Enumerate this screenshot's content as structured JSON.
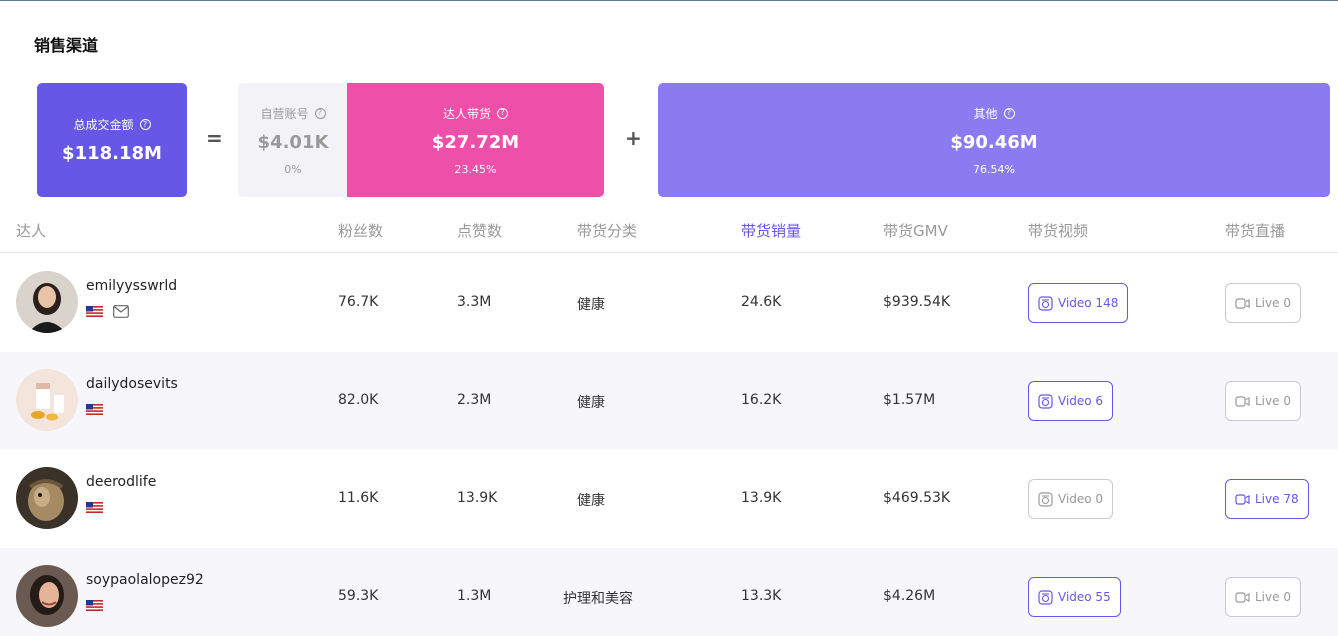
{
  "section_title": "销售渠道",
  "summary": {
    "total": {
      "label": "总成交金额",
      "value": "$118.18M"
    },
    "equals": "=",
    "self": {
      "label": "自营账号",
      "value": "$4.01K",
      "pct": "0%"
    },
    "kol": {
      "label": "达人带货",
      "value": "$27.72M",
      "pct": "23.45%"
    },
    "plus": "+",
    "other": {
      "label": "其他",
      "value": "$90.46M",
      "pct": "76.54%"
    }
  },
  "table": {
    "headers": [
      "达人",
      "粉丝数",
      "点赞数",
      "带货分类",
      "带货销量",
      "带货GMV",
      "带货视频",
      "带货直播"
    ],
    "rows": [
      {
        "name": "emilyysswrld",
        "followers": "76.7K",
        "likes": "3.3M",
        "category": "健康",
        "sales": "24.6K",
        "gmv": "$939.54K",
        "video": "Video 148",
        "live": "Live 0"
      },
      {
        "name": "dailydosevits",
        "followers": "82.0K",
        "likes": "2.3M",
        "category": "健康",
        "sales": "16.2K",
        "gmv": "$1.57M",
        "video": "Video 6",
        "live": "Live 0"
      },
      {
        "name": "deerodlife",
        "followers": "11.6K",
        "likes": "13.9K",
        "category": "健康",
        "sales": "13.9K",
        "gmv": "$469.53K",
        "video": "Video 0",
        "live": "Live 78"
      },
      {
        "name": "soypaolalopez92",
        "followers": "59.3K",
        "likes": "1.3M",
        "category": "护理和美容",
        "sales": "13.3K",
        "gmv": "$4.26M",
        "video": "Video 55",
        "live": "Live 0"
      }
    ]
  },
  "icons": {
    "help": "question-circle-icon",
    "flag": "us-flag-icon",
    "mail": "envelope-icon",
    "video": "video-icon",
    "live": "live-camera-icon"
  },
  "colors": {
    "accent": "#6657e6",
    "kol": "#ee4fa9",
    "other": "#8a7bf1"
  }
}
